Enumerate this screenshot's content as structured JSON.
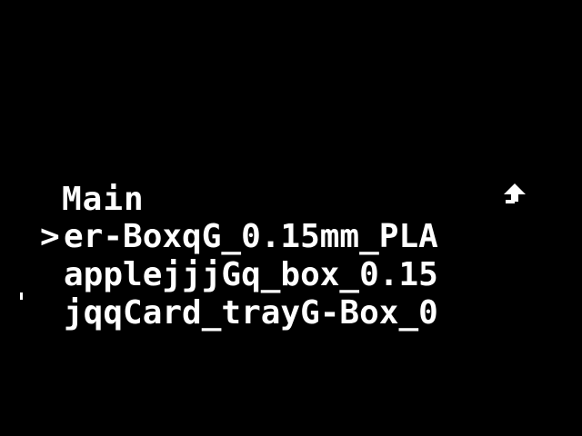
{
  "header": {
    "title": "Main",
    "back_icon": "back-arrow-icon"
  },
  "menu": {
    "cursor": ">",
    "items": [
      {
        "label": "er-BoxqG_0.15mm_PLA",
        "selected": true
      },
      {
        "label": "applejjjGq_box_0.15",
        "selected": false
      },
      {
        "label": "jqqCard_trayG-Box_0",
        "selected": false
      }
    ]
  },
  "colors": {
    "background": "#000000",
    "foreground": "#ffffff"
  }
}
